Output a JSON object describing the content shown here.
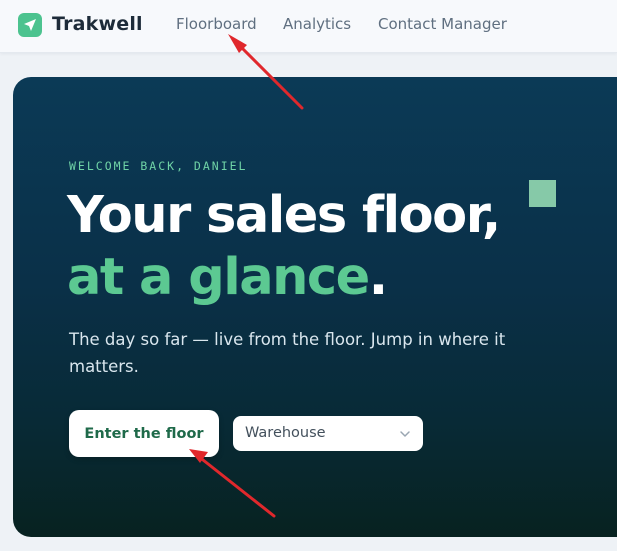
{
  "app": {
    "brand": "Trakwell",
    "logo_icon": "send-arrow-icon",
    "accent_color": "#4cc38f"
  },
  "nav": {
    "items": [
      {
        "label": "Floorboard"
      },
      {
        "label": "Analytics"
      },
      {
        "label": "Contact Manager"
      }
    ]
  },
  "hero": {
    "eyebrow": "WELCOME BACK, DANIEL",
    "headline_line1": "Your sales floor,",
    "headline_line2": "at a glance",
    "headline_period": ".",
    "subtitle": "The day so far — live from the floor. Jump in where it matters.",
    "cta_label": "Enter the floor",
    "location_select": {
      "selected": "Warehouse"
    },
    "colors": {
      "background_top": "#0b3a56",
      "background_bottom": "#072220",
      "accent_green": "#5cc992"
    }
  }
}
